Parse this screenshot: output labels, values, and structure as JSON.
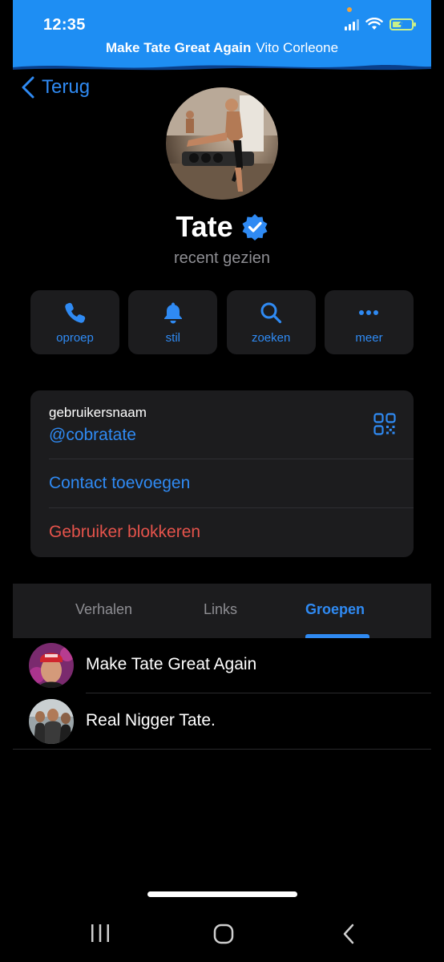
{
  "status_bar": {
    "time": "12:35",
    "icons": [
      "signal-icon",
      "wifi-icon",
      "battery-charging-icon"
    ]
  },
  "call_banner": {
    "title": "Make Tate Great Again",
    "subtitle": "Vito Corleone"
  },
  "nav": {
    "back_label": "Terug"
  },
  "profile": {
    "name": "Tate",
    "verified": true,
    "last_seen": "recent gezien"
  },
  "actions": [
    {
      "label": "oproep",
      "icon": "phone-icon"
    },
    {
      "label": "stil",
      "icon": "bell-icon"
    },
    {
      "label": "zoeken",
      "icon": "search-icon"
    },
    {
      "label": "meer",
      "icon": "more-icon"
    }
  ],
  "info": {
    "username_label": "gebruikersnaam",
    "username_value": "@cobratate",
    "add_contact": "Contact toevoegen",
    "block_user": "Gebruiker blokkeren"
  },
  "tabs": {
    "items": [
      "Verhalen",
      "Links",
      "Groepen"
    ],
    "active": "Groepen"
  },
  "groups": [
    {
      "name": "Make Tate Great Again"
    },
    {
      "name": "Real Nigger Tate."
    }
  ],
  "colors": {
    "accent": "#2f8af3",
    "danger": "#e5534b",
    "banner": "#1e8ef3",
    "card": "#1c1c1e",
    "background": "#000000"
  }
}
